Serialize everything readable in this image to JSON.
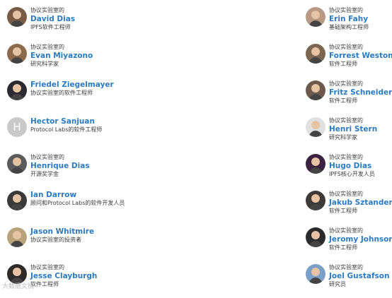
{
  "left": [
    {
      "company": "协议实验室的",
      "name": "David Dias",
      "role": "IPFS软件工程师",
      "avatar": "#7a5a44"
    },
    {
      "company": "协议实验室的",
      "name": "Evan Miyazono",
      "role": "研究科学家",
      "avatar": "#8e6a4c"
    },
    {
      "company": "",
      "name": "Friedel Ziegelmayer",
      "role": "协议实验室的软件工程师",
      "avatar": "#2c2a30"
    },
    {
      "company": "",
      "name": "Hector Sanjuan",
      "role": "Protocol Labs的软件工程师",
      "avatar": "placeholder",
      "avatar_letter": "H"
    },
    {
      "company": "协议实验室的",
      "name": "Henrique Dias",
      "role": "开源奖学金",
      "avatar": "#5a5a5a"
    },
    {
      "company": "",
      "name": "Ian Darrow",
      "role": "顾问和Protocol Labs的软件开发人员",
      "avatar": "#3a3a3a"
    },
    {
      "company": "",
      "name": "Jason Whitmire",
      "role": "协议实验室的投资者",
      "avatar": "#b8a27a"
    },
    {
      "company": "协议实验室的",
      "name": "Jesse Clayburgh",
      "role": "软件工程师",
      "avatar": "#2e2a2a"
    }
  ],
  "right": [
    {
      "company": "协议实验室的",
      "name": "Erin Fahy",
      "role": "基础架构工程师",
      "avatar": "#b89a84"
    },
    {
      "company": "协议实验室的",
      "name": "Forrest Weston",
      "role": "软件工程师",
      "avatar": "#7d6651"
    },
    {
      "company": "协议实验室的",
      "name": "Fritz Schneider",
      "role": "软件工程师",
      "avatar": "#6d5a4d"
    },
    {
      "company": "协议实验室的",
      "name": "Henri Stern",
      "role": "研究科学家",
      "avatar": "#e0e0e0"
    },
    {
      "company": "协议实验室的",
      "name": "Hugo Dias",
      "role": "IPFS核心开发人员",
      "avatar": "#3b2240"
    },
    {
      "company": "协议实验室的",
      "name": "Jakub Sztandera",
      "role": "软件工程师",
      "avatar": "#3e3a38"
    },
    {
      "company": "协议实验室的",
      "name": "Jeromy Johnson",
      "role": "软件工程师",
      "avatar": "#2b2b2b"
    },
    {
      "company": "协议实验室的",
      "name": "Joel Gustafson",
      "role": "研究员",
      "avatar": "#7aa0c8"
    }
  ],
  "watermark": "大数据文摘"
}
